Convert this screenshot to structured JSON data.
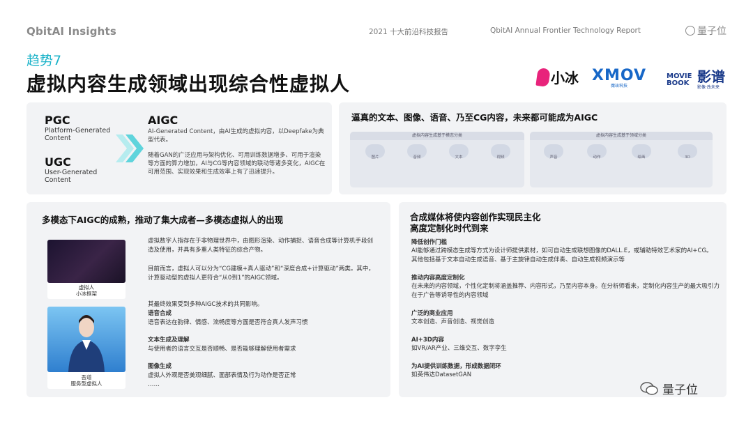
{
  "header": {
    "brand": "QbitAI Insights",
    "report_cn": "2021 十大前沿科技报告",
    "report_en": "QbitAI  Annual Frontier Technology Report",
    "logo_text": "量子位"
  },
  "trend_label": "趋势7",
  "title": "虚拟内容生成领域出现综合性虚拟人",
  "logos": {
    "xiaobing": "小冰",
    "xmov": "XMOV",
    "xmov_sub": "魔珐科技",
    "moviebook": "MOVIE BOOK",
    "yingpu": "影谱",
    "yingpu_sub": "影像·改未来"
  },
  "panel_aigc": {
    "pgc": "PGC",
    "pgc_sub1": "Platform-Generated",
    "pgc_sub2": "Content",
    "ugc": "UGC",
    "ugc_sub1": "User-Generated",
    "ugc_sub2": "Content",
    "aigc": "AIGC",
    "aigc_desc1": "AI-Generated Content，由AI生成的虚拟内容，以Deepfake为典型代表。",
    "aigc_desc2": "随着GAN的广泛应用与架构优化、可用训练数据增多、可用于渲染等方面的算力增加，AI与CG等内容领域的联动等诸多变化，AIGC在可用范围、实现效果和生成效率上有了迅速提升。"
  },
  "panel_generate": {
    "title": "逼真的文本、图像、语音、乃至CG内容，未来都可能成为AIGC",
    "left_header": "虚拟内容生成基于模态分类",
    "right_header": "虚拟内容生成基于领域分类",
    "left_items": [
      "图片",
      "音频",
      "文本",
      "视频"
    ],
    "right_items": [
      "声音",
      "动作",
      "绘画",
      "3D"
    ]
  },
  "panel_multimodal": {
    "title": "多模态下AIGC的成熟，推动了集大成者—多模态虚拟人的出现",
    "pic1_caption1": "虚拟人",
    "pic1_caption2": "小冰框架",
    "pic2_caption1": "吾道",
    "pic2_caption2": "服务型虚拟人",
    "para1": "虚拟数字人指存在于非物理世界中，由图形渲染、动作捕捉、语音合成等计算机手段创造及使用，并具有多重人类特征的综合产物。",
    "para2": "目前而言，虚拟人可以分为“CG建模+真人驱动”和“深度合成+计算驱动”两类。其中，计算驱动型的虚拟人更符合“从0到1”的AIGC领域。",
    "para3": "其最终效果受到多种AIGC技术的共同影响。",
    "h1": "语音合成",
    "t1": "语音表达在韵律、情感、流畅度等方面是否符合真人发声习惯",
    "h2": "文本生成及理解",
    "t2": "与使用者的语言交互是否顺畅、是否能够理解使用者需求",
    "h3": "图像生成",
    "t3": "虚拟人外观是否美观细腻、面部表情及行为动作是否正常",
    "ellipsis": "……"
  },
  "panel_media": {
    "title1": "合成媒体将使内容创作实现民主化",
    "title2": "高度定制化时代到来",
    "h1": "降低创作门槛",
    "t1a": "AI能够通过跨模态生成等方式为设计师提供素材，如可自动生成联想图像的DALL.E，或辅助特效艺术家的AI+CG。",
    "t1b": "其他包括基于文本自动生成语音、基于主旋律自动生成伴奏、自动生成视频演示等",
    "h2": "推动内容高度定制化",
    "t2": "在未来的内容领域，个性化定制将涵盖推荐、内容形式，乃至内容本身。在分析师看来，定制化内容生产的最大吸引力在于广告等诱导性的内容领域",
    "h3": "广泛的商业应用",
    "t3": "文本创造、声音创造、视觉创造",
    "h4": "AI+3D内容",
    "t4": "如VR/AR产业、三维交互、数字孪生",
    "h5": "为AI提供训练数据，形成数据闭环",
    "t5": "如英伟达DatasetGAN"
  },
  "watermark": "量子位",
  "colors": {
    "accent": "#17a8bf",
    "panel": "#f2f3f5"
  }
}
